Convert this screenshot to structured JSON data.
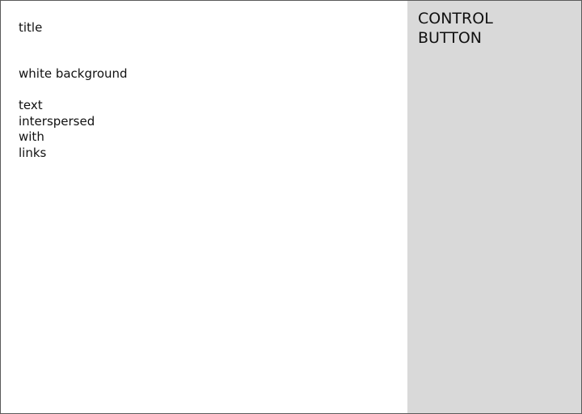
{
  "content": {
    "title": "title",
    "background_note": "white background",
    "paragraph_lines": [
      "text",
      "interspersed",
      "with",
      "links"
    ]
  },
  "control": {
    "button_lines": [
      "CONTROL",
      "BUTTON"
    ]
  },
  "colors": {
    "content_background": "#ffffff",
    "control_background": "#d9d9d9",
    "border": "#5a5a5a",
    "text": "#111111"
  }
}
